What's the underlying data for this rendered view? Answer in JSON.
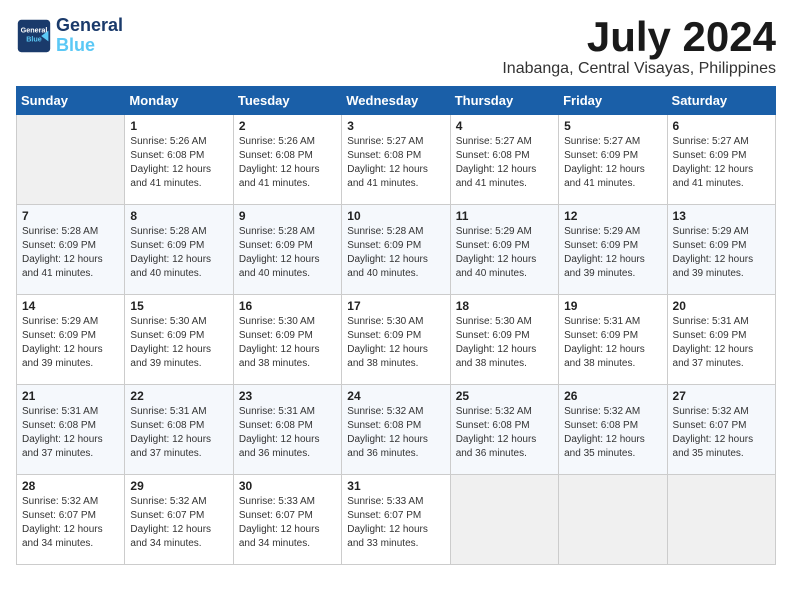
{
  "logo": {
    "line1": "General",
    "line2": "Blue"
  },
  "title": "July 2024",
  "location": "Inabanga, Central Visayas, Philippines",
  "days_of_week": [
    "Sunday",
    "Monday",
    "Tuesday",
    "Wednesday",
    "Thursday",
    "Friday",
    "Saturday"
  ],
  "weeks": [
    [
      {
        "date": "",
        "info": ""
      },
      {
        "date": "1",
        "info": "Sunrise: 5:26 AM\nSunset: 6:08 PM\nDaylight: 12 hours\nand 41 minutes."
      },
      {
        "date": "2",
        "info": "Sunrise: 5:26 AM\nSunset: 6:08 PM\nDaylight: 12 hours\nand 41 minutes."
      },
      {
        "date": "3",
        "info": "Sunrise: 5:27 AM\nSunset: 6:08 PM\nDaylight: 12 hours\nand 41 minutes."
      },
      {
        "date": "4",
        "info": "Sunrise: 5:27 AM\nSunset: 6:08 PM\nDaylight: 12 hours\nand 41 minutes."
      },
      {
        "date": "5",
        "info": "Sunrise: 5:27 AM\nSunset: 6:09 PM\nDaylight: 12 hours\nand 41 minutes."
      },
      {
        "date": "6",
        "info": "Sunrise: 5:27 AM\nSunset: 6:09 PM\nDaylight: 12 hours\nand 41 minutes."
      }
    ],
    [
      {
        "date": "7",
        "info": "Sunrise: 5:28 AM\nSunset: 6:09 PM\nDaylight: 12 hours\nand 41 minutes."
      },
      {
        "date": "8",
        "info": "Sunrise: 5:28 AM\nSunset: 6:09 PM\nDaylight: 12 hours\nand 40 minutes."
      },
      {
        "date": "9",
        "info": "Sunrise: 5:28 AM\nSunset: 6:09 PM\nDaylight: 12 hours\nand 40 minutes."
      },
      {
        "date": "10",
        "info": "Sunrise: 5:28 AM\nSunset: 6:09 PM\nDaylight: 12 hours\nand 40 minutes."
      },
      {
        "date": "11",
        "info": "Sunrise: 5:29 AM\nSunset: 6:09 PM\nDaylight: 12 hours\nand 40 minutes."
      },
      {
        "date": "12",
        "info": "Sunrise: 5:29 AM\nSunset: 6:09 PM\nDaylight: 12 hours\nand 39 minutes."
      },
      {
        "date": "13",
        "info": "Sunrise: 5:29 AM\nSunset: 6:09 PM\nDaylight: 12 hours\nand 39 minutes."
      }
    ],
    [
      {
        "date": "14",
        "info": "Sunrise: 5:29 AM\nSunset: 6:09 PM\nDaylight: 12 hours\nand 39 minutes."
      },
      {
        "date": "15",
        "info": "Sunrise: 5:30 AM\nSunset: 6:09 PM\nDaylight: 12 hours\nand 39 minutes."
      },
      {
        "date": "16",
        "info": "Sunrise: 5:30 AM\nSunset: 6:09 PM\nDaylight: 12 hours\nand 38 minutes."
      },
      {
        "date": "17",
        "info": "Sunrise: 5:30 AM\nSunset: 6:09 PM\nDaylight: 12 hours\nand 38 minutes."
      },
      {
        "date": "18",
        "info": "Sunrise: 5:30 AM\nSunset: 6:09 PM\nDaylight: 12 hours\nand 38 minutes."
      },
      {
        "date": "19",
        "info": "Sunrise: 5:31 AM\nSunset: 6:09 PM\nDaylight: 12 hours\nand 38 minutes."
      },
      {
        "date": "20",
        "info": "Sunrise: 5:31 AM\nSunset: 6:09 PM\nDaylight: 12 hours\nand 37 minutes."
      }
    ],
    [
      {
        "date": "21",
        "info": "Sunrise: 5:31 AM\nSunset: 6:08 PM\nDaylight: 12 hours\nand 37 minutes."
      },
      {
        "date": "22",
        "info": "Sunrise: 5:31 AM\nSunset: 6:08 PM\nDaylight: 12 hours\nand 37 minutes."
      },
      {
        "date": "23",
        "info": "Sunrise: 5:31 AM\nSunset: 6:08 PM\nDaylight: 12 hours\nand 36 minutes."
      },
      {
        "date": "24",
        "info": "Sunrise: 5:32 AM\nSunset: 6:08 PM\nDaylight: 12 hours\nand 36 minutes."
      },
      {
        "date": "25",
        "info": "Sunrise: 5:32 AM\nSunset: 6:08 PM\nDaylight: 12 hours\nand 36 minutes."
      },
      {
        "date": "26",
        "info": "Sunrise: 5:32 AM\nSunset: 6:08 PM\nDaylight: 12 hours\nand 35 minutes."
      },
      {
        "date": "27",
        "info": "Sunrise: 5:32 AM\nSunset: 6:07 PM\nDaylight: 12 hours\nand 35 minutes."
      }
    ],
    [
      {
        "date": "28",
        "info": "Sunrise: 5:32 AM\nSunset: 6:07 PM\nDaylight: 12 hours\nand 34 minutes."
      },
      {
        "date": "29",
        "info": "Sunrise: 5:32 AM\nSunset: 6:07 PM\nDaylight: 12 hours\nand 34 minutes."
      },
      {
        "date": "30",
        "info": "Sunrise: 5:33 AM\nSunset: 6:07 PM\nDaylight: 12 hours\nand 34 minutes."
      },
      {
        "date": "31",
        "info": "Sunrise: 5:33 AM\nSunset: 6:07 PM\nDaylight: 12 hours\nand 33 minutes."
      },
      {
        "date": "",
        "info": ""
      },
      {
        "date": "",
        "info": ""
      },
      {
        "date": "",
        "info": ""
      }
    ]
  ]
}
